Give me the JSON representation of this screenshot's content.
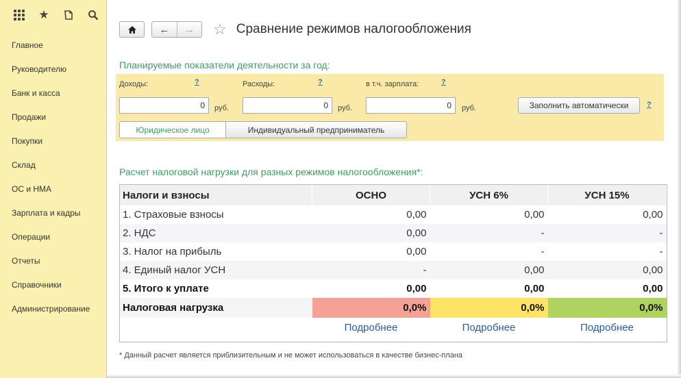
{
  "sidebar": {
    "items": [
      {
        "label": "Главное"
      },
      {
        "label": "Руководителю"
      },
      {
        "label": "Банк и касса"
      },
      {
        "label": "Продажи"
      },
      {
        "label": "Покупки"
      },
      {
        "label": "Склад"
      },
      {
        "label": "ОС и НМА"
      },
      {
        "label": "Зарплата и кадры"
      },
      {
        "label": "Операции"
      },
      {
        "label": "Отчеты"
      },
      {
        "label": "Справочники"
      },
      {
        "label": "Администрирование"
      }
    ],
    "top_icons": [
      "apps-grid-icon",
      "star-icon",
      "history-icon",
      "search-icon"
    ]
  },
  "header": {
    "title": "Сравнение режимов налогообложения"
  },
  "planned": {
    "section_title": "Планируемые показатели деятельности за год:",
    "income_label": "Доходы:",
    "expenses_label": "Расходы:",
    "salary_label": "в т.ч. зарплата:",
    "help": "?",
    "income_value": "0",
    "expenses_value": "0",
    "salary_value": "0",
    "unit": "руб.",
    "fill_button": "Заполнить автоматически",
    "entity_options": [
      "Юридическое лицо",
      "Индивидуальный предприниматель"
    ],
    "entity_selected": "Юридическое лицо"
  },
  "calc": {
    "section_title": "Расчет налоговой нагрузки для разных режимов налогообложения*:",
    "columns": [
      "Налоги и взносы",
      "ОСНО",
      "УСН 6%",
      "УСН 15%"
    ],
    "rows": [
      [
        "1. Страховые взносы",
        "0,00",
        "0,00",
        "0,00"
      ],
      [
        "2. НДС",
        "0,00",
        "-",
        "-"
      ],
      [
        "3. Налог на прибыль",
        "0,00",
        "-",
        "-"
      ],
      [
        "4. Единый налог УСН",
        "-",
        "0,00",
        "0,00"
      ]
    ],
    "total": [
      "5. Итого к уплате",
      "0,00",
      "0,00",
      "0,00"
    ],
    "burden": [
      "Налоговая нагрузка",
      "0,0%",
      "0,0%",
      "0,0%"
    ],
    "burden_colors": [
      "#f5a196",
      "#fde467",
      "#aed35f"
    ],
    "details_link": "Подробнее"
  },
  "footnote": "* Данный расчет является приблизительным и не может использоваться в качестве бизнес-плана"
}
